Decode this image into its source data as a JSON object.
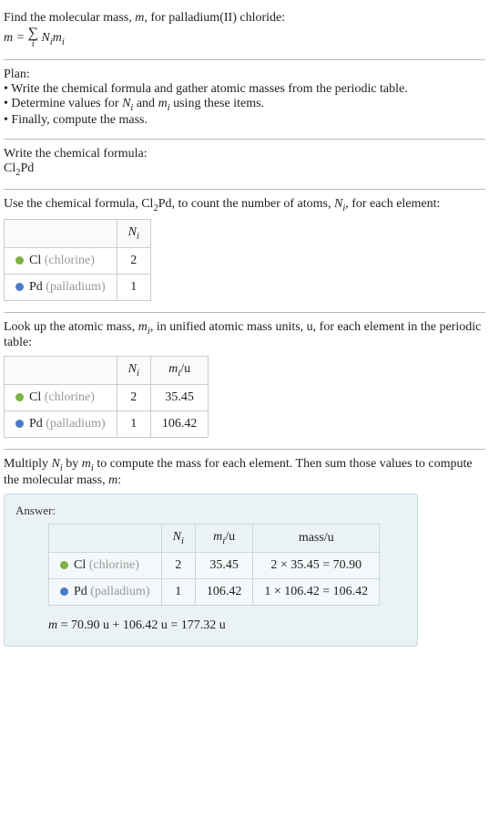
{
  "intro": {
    "line1_a": "Find the molecular mass, ",
    "line1_b": ", for palladium(II) chloride:"
  },
  "plan": {
    "title": "Plan:",
    "b1_a": "• Write the chemical formula and gather atomic masses from the periodic table.",
    "b2_a": "• Determine values for ",
    "b2_b": " and ",
    "b2_c": " using these items.",
    "b3": "• Finally, compute the mass."
  },
  "writeFormula": {
    "title": "Write the chemical formula:",
    "formula_prefix": "Cl",
    "formula_sub": "2",
    "formula_suffix": "Pd"
  },
  "countAtoms": {
    "text_a": "Use the chemical formula, Cl",
    "text_sub": "2",
    "text_b": "Pd, to count the number of atoms, ",
    "text_c": ", for each element:"
  },
  "table1": {
    "h2": "N",
    "h2_sub": "i",
    "r1_sym": "Cl",
    "r1_name": " (chlorine)",
    "r1_n": "2",
    "r2_sym": "Pd",
    "r2_name": " (palladium)",
    "r2_n": "1"
  },
  "lookup": {
    "text_a": "Look up the atomic mass, ",
    "text_b": ", in unified atomic mass units, u, for each element in the periodic table:"
  },
  "table2": {
    "h2": "N",
    "h2_sub": "i",
    "h3": "m",
    "h3_sub": "i",
    "h3_suffix": "/u",
    "r1_sym": "Cl",
    "r1_name": " (chlorine)",
    "r1_n": "2",
    "r1_m": "35.45",
    "r2_sym": "Pd",
    "r2_name": " (palladium)",
    "r2_n": "1",
    "r2_m": "106.42"
  },
  "multiply": {
    "text_a": "Multiply ",
    "text_b": " by ",
    "text_c": " to compute the mass for each element. Then sum those values to compute the molecular mass, ",
    "text_d": ":"
  },
  "answer": {
    "label": "Answer:",
    "h2": "N",
    "h2_sub": "i",
    "h3": "m",
    "h3_sub": "i",
    "h3_suffix": "/u",
    "h4": "mass/u",
    "r1_sym": "Cl",
    "r1_name": " (chlorine)",
    "r1_n": "2",
    "r1_m": "35.45",
    "r1_mass": "2 × 35.45 = 70.90",
    "r2_sym": "Pd",
    "r2_name": " (palladium)",
    "r2_n": "1",
    "r2_m": "106.42",
    "r2_mass": "1 × 106.42 = 106.42",
    "result_a": "m",
    "result_b": " = 70.90 u + 106.42 u = 177.32 u"
  },
  "sym": {
    "m": "m",
    "N": "N",
    "i": "i",
    "mi": "m"
  }
}
